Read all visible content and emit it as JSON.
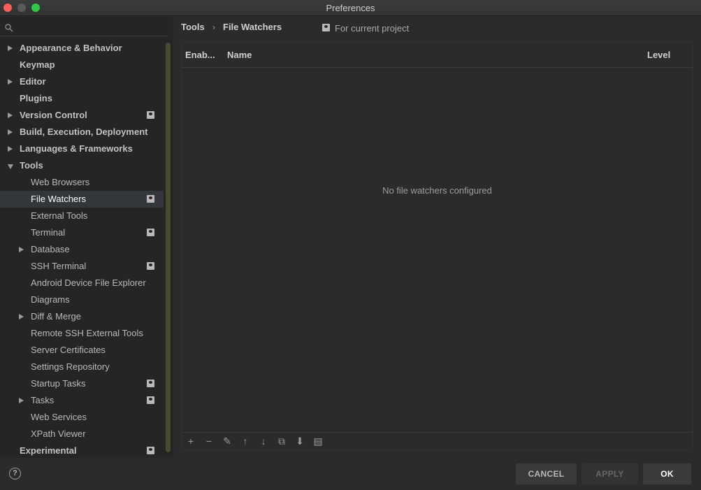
{
  "window": {
    "title": "Preferences"
  },
  "breadcrumb": {
    "parent": "Tools",
    "separator": "›",
    "current": "File Watchers",
    "scope_label": "For current project"
  },
  "sidebar": {
    "items": [
      {
        "label": "Appearance & Behavior",
        "level": 0,
        "arrow": "right",
        "project": false
      },
      {
        "label": "Keymap",
        "level": 0,
        "arrow": "",
        "project": false
      },
      {
        "label": "Editor",
        "level": 0,
        "arrow": "right",
        "project": false
      },
      {
        "label": "Plugins",
        "level": 0,
        "arrow": "",
        "project": false
      },
      {
        "label": "Version Control",
        "level": 0,
        "arrow": "right",
        "project": true
      },
      {
        "label": "Build, Execution, Deployment",
        "level": 0,
        "arrow": "right",
        "project": false
      },
      {
        "label": "Languages & Frameworks",
        "level": 0,
        "arrow": "right",
        "project": false
      },
      {
        "label": "Tools",
        "level": 0,
        "arrow": "down",
        "project": false
      },
      {
        "label": "Web Browsers",
        "level": 1,
        "arrow": "",
        "project": false
      },
      {
        "label": "File Watchers",
        "level": 1,
        "arrow": "",
        "project": true,
        "selected": true
      },
      {
        "label": "External Tools",
        "level": 1,
        "arrow": "",
        "project": false
      },
      {
        "label": "Terminal",
        "level": 1,
        "arrow": "",
        "project": true
      },
      {
        "label": "Database",
        "level": 1,
        "arrow": "right",
        "project": false
      },
      {
        "label": "SSH Terminal",
        "level": 1,
        "arrow": "",
        "project": true
      },
      {
        "label": "Android Device File Explorer",
        "level": 1,
        "arrow": "",
        "project": false
      },
      {
        "label": "Diagrams",
        "level": 1,
        "arrow": "",
        "project": false
      },
      {
        "label": "Diff & Merge",
        "level": 1,
        "arrow": "right",
        "project": false
      },
      {
        "label": "Remote SSH External Tools",
        "level": 1,
        "arrow": "",
        "project": false
      },
      {
        "label": "Server Certificates",
        "level": 1,
        "arrow": "",
        "project": false
      },
      {
        "label": "Settings Repository",
        "level": 1,
        "arrow": "",
        "project": false
      },
      {
        "label": "Startup Tasks",
        "level": 1,
        "arrow": "",
        "project": true
      },
      {
        "label": "Tasks",
        "level": 1,
        "arrow": "right",
        "project": true
      },
      {
        "label": "Web Services",
        "level": 1,
        "arrow": "",
        "project": false
      },
      {
        "label": "XPath Viewer",
        "level": 1,
        "arrow": "",
        "project": false
      },
      {
        "label": "Experimental",
        "level": 0,
        "arrow": "",
        "project": true
      }
    ]
  },
  "table": {
    "columns": {
      "enabled": "Enab...",
      "name": "Name",
      "level": "Level"
    },
    "empty_text": "No file watchers configured",
    "toolbar": [
      {
        "icon": "add-icon",
        "glyph": "+"
      },
      {
        "icon": "remove-icon",
        "glyph": "−"
      },
      {
        "icon": "edit-icon",
        "glyph": "✎"
      },
      {
        "icon": "move-up-icon",
        "glyph": "↑"
      },
      {
        "icon": "move-down-icon",
        "glyph": "↓"
      },
      {
        "icon": "copy-icon",
        "glyph": "⧉"
      },
      {
        "icon": "import-icon",
        "glyph": "⬇"
      },
      {
        "icon": "export-icon",
        "glyph": "▤"
      }
    ]
  },
  "footer": {
    "help_glyph": "?",
    "cancel_label": "CANCEL",
    "apply_label": "APPLY",
    "ok_label": "OK"
  }
}
